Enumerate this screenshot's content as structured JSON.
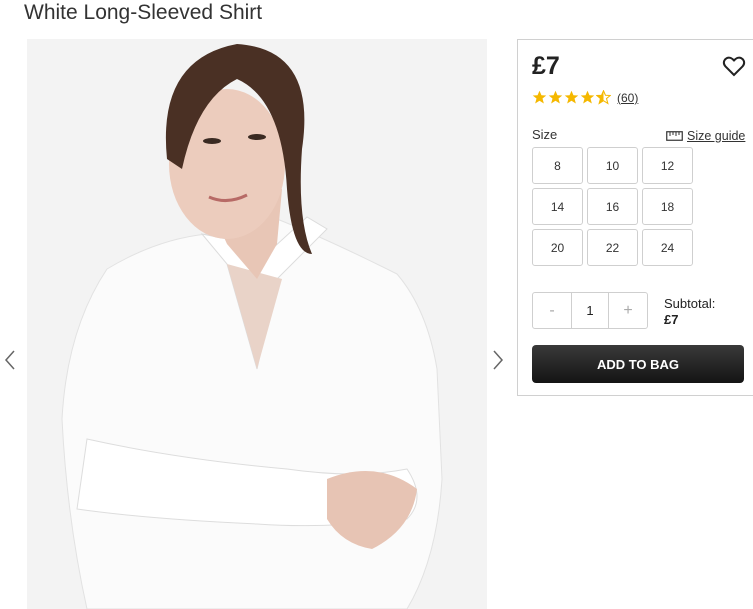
{
  "product": {
    "title": "White Long-Sleeved Shirt",
    "image_alt": "Woman wearing white long-sleeved shirt"
  },
  "gallery": {
    "prev_icon": "chevron-left-icon",
    "next_icon": "chevron-right-icon"
  },
  "panel": {
    "price": "£7",
    "wishlist_icon": "heart-outline-icon",
    "rating": {
      "value": 4.5,
      "max": 5,
      "count_label": "(60)",
      "star_color": "#f5b800"
    },
    "size_label": "Size",
    "size_guide_label": "Size guide",
    "size_guide_icon": "ruler-icon",
    "sizes": [
      "8",
      "10",
      "12",
      "14",
      "16",
      "18",
      "20",
      "22",
      "24"
    ],
    "quantity": {
      "minus": "-",
      "value": "1",
      "plus": "+"
    },
    "subtotal_label": "Subtotal:",
    "subtotal_value": "£7",
    "add_to_bag_label": "ADD TO BAG"
  }
}
